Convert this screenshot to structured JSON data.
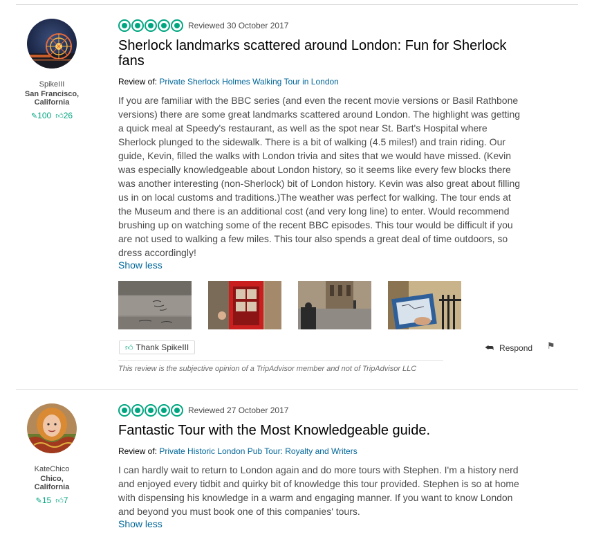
{
  "reviews": [
    {
      "member": {
        "username": "SpikeIII",
        "location_line1": "San Francisco,",
        "location_line2": "California",
        "reviews_count": "100",
        "helpful_count": "26"
      },
      "rating": 5,
      "date": "Reviewed 30 October 2017",
      "title": "Sherlock landmarks scattered around London: Fun for Sherlock fans",
      "review_of_label": "Review of:",
      "review_of_link": "Private Sherlock Holmes Walking Tour in London",
      "body": "If you are familiar with the BBC series (and even the recent movie versions or Basil Rathbone versions) there are some great landmarks scattered around London. The highlight was getting a quick meal at Speedy's restaurant, as well as the spot near St. Bart's Hospital where Sherlock plunged to the sidewalk. There is a bit of walking (4.5 miles!) and train riding. Our guide, Kevin, filled the walks with London trivia and sites that we would have missed. (Kevin was especially knowledgeable about London history, so it seems like every few blocks there was another interesting (non-Sherlock) bit of London history. Kevin was also great about filling us in on local customs and traditions.)The weather was perfect for walking. The tour ends at the Museum and there is an additional cost (and very long line) to enter. Would recommend brushing up on watching some of the recent BBC episodes. This tour would be difficult if you are not used to walking a few miles. This tour also spends a great deal of time outdoors, so dress accordingly!",
      "show_less": "Show less",
      "thank_label": "Thank SpikeIII",
      "respond_label": "Respond",
      "disclaimer": "This review is the subjective opinion of a TripAdvisor member and not of TripAdvisor LLC"
    },
    {
      "member": {
        "username": "KateChico",
        "location_line1": "Chico,",
        "location_line2": "California",
        "reviews_count": "15",
        "helpful_count": "7"
      },
      "rating": 5,
      "date": "Reviewed 27 October 2017",
      "title": "Fantastic Tour with the Most Knowledgeable guide.",
      "review_of_label": "Review of:",
      "review_of_link": "Private Historic London Pub Tour: Royalty and Writers",
      "body": "I can hardly wait to return to London again and do more tours with Stephen. I'm a history nerd and enjoyed every tidbit and quirky bit of knowledge this tour provided. Stephen is so at home with dispensing his knowledge in a warm and engaging manner. If you want to know London and beyond you must book one of this companies' tours.",
      "show_less": "Show less"
    }
  ],
  "icons": {
    "review_count": "pencil-icon",
    "helpful_count": "thumbs-up-icon",
    "respond": "reply-arrow-icon",
    "flag": "flag-icon"
  },
  "colors": {
    "accent_green": "#00a680",
    "link_blue": "#006699"
  }
}
